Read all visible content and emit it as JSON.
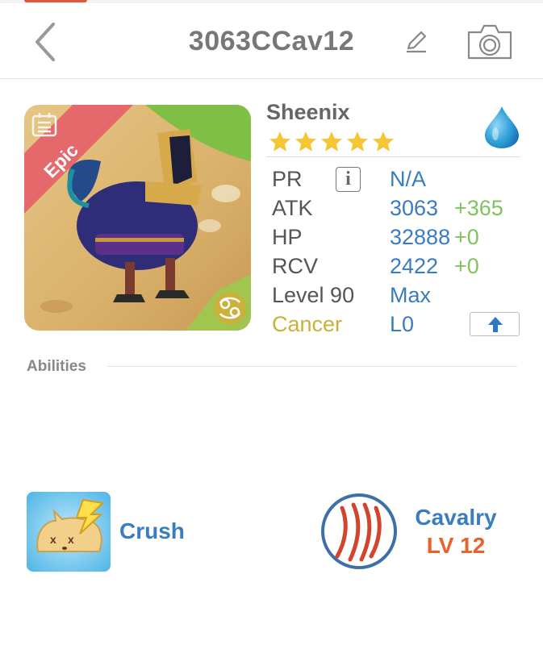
{
  "header": {
    "title": "3063CCav12"
  },
  "pet": {
    "rarity": "Epic",
    "name": "Sheenix",
    "stars": 5,
    "element": "water",
    "zodiac_icon": "cancer-zodiac-icon"
  },
  "stats": {
    "pr_label": "PR",
    "pr_value": "N/A",
    "atk_label": "ATK",
    "atk_value": "3063",
    "atk_bonus": "+365",
    "hp_label": "HP",
    "hp_value": "32888",
    "hp_bonus": "+0",
    "rcv_label": "RCV",
    "rcv_value": "2422",
    "rcv_bonus": "+0",
    "level_label": "Level 90",
    "level_value": "Max",
    "sign_label": "Cancer",
    "sign_value": "L0"
  },
  "abilities": {
    "section_label": "Abilities",
    "ability_name": "Crush",
    "skill_name": "Cavalry",
    "skill_level": "LV 12"
  },
  "colors": {
    "accent_blue": "#3a7cc1",
    "bonus_green": "#7ec45e",
    "zodiac_gold": "#c9b13a",
    "skill_orange": "#e8632b",
    "epic_ribbon": "#e5636a"
  }
}
